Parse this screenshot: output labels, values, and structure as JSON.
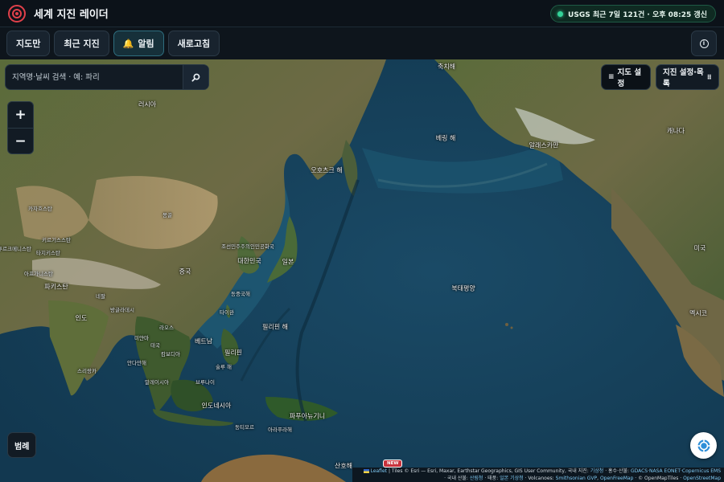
{
  "app": {
    "title": "세계 지진 레이더",
    "status": "USGS 최근 7일 121건 · 오후 08:25 갱신",
    "accent": "#e0404a",
    "status_color": "#34d399"
  },
  "toolbar": {
    "buttons": [
      "지도만",
      "최근 지진",
      "알림",
      "새로고침"
    ],
    "info_icon": "info-icon"
  },
  "search": {
    "placeholder": "지역명·날씨 검색 · 예: 파리"
  },
  "map_controls": {
    "map_settings": "지도 설정",
    "quake_settings": "지진 설정·목록",
    "zoom_in": "+",
    "zoom_out": "−",
    "legend": "범례",
    "new_badge": "NEW"
  },
  "places": {
    "okhotsk_sea": "오호츠크 해",
    "bering_sea": "베링 해",
    "alaska_peninsula": "알래스카만",
    "chukchi_sea": "축치해",
    "russia": "러시아",
    "canada": "캐나다",
    "usa": "미국",
    "mexico": "멕시코",
    "mongolia": "몽골",
    "kazakhstan": "카자흐스탄",
    "kyrgyzstan": "키르기스스탄",
    "tajikistan": "타지키스탄",
    "turkmenistan": "투르크메니스탄",
    "afghanistan": "아프가니스탄",
    "pakistan": "파키스탄",
    "nepal": "네팔",
    "bangladesh": "방글라데시",
    "india": "인도",
    "sri_lanka": "스리랑카",
    "myanmar": "미얀마",
    "laos": "라오스",
    "thailand": "태국",
    "vietnam": "베트남",
    "cambodia": "캄보디아",
    "andaman_sea": "안다만해",
    "malaysia": "말레이시아",
    "brunei": "브루나이",
    "china": "중국",
    "north_korea": "조선민주주의인민공화국",
    "south_korea": "대한민국",
    "japan": "일본",
    "east_china_sea": "동중국해",
    "taiwan": "타이완",
    "philippine_sea": "필리핀 해",
    "philippines": "필리핀",
    "sulu_sea": "술루 해",
    "indonesia": "인도네시아",
    "timor_leste": "동티모르",
    "arafura_sea": "아라푸라해",
    "papua_new_guinea": "파푸아뉴기니",
    "north_pacific": "북태평양",
    "coral_sea": "산호해"
  },
  "attribution": {
    "leaflet": "Leaflet",
    "line1": "| Tiles © Esri — Esri, Maxar, Earthstar Geographics, GIS User Community, 국내 지진:",
    "kma": "기상청",
    "line1b": "· 홍수·산불:",
    "gdacs": "GDACS·NASA EONET·Copernicus EMS",
    "line2a": "· 국내 산불:",
    "forest": "산림청",
    "line2b": "· 태풍:",
    "jma": "일본 기상청",
    "line2c": "· Volcanoes:",
    "smithsonian": "Smithsonian GVP",
    "openfreemap": "OpenFreeMap",
    "line2d": "· © OpenMapTiles ·",
    "osm": "OpenStreetMap"
  }
}
